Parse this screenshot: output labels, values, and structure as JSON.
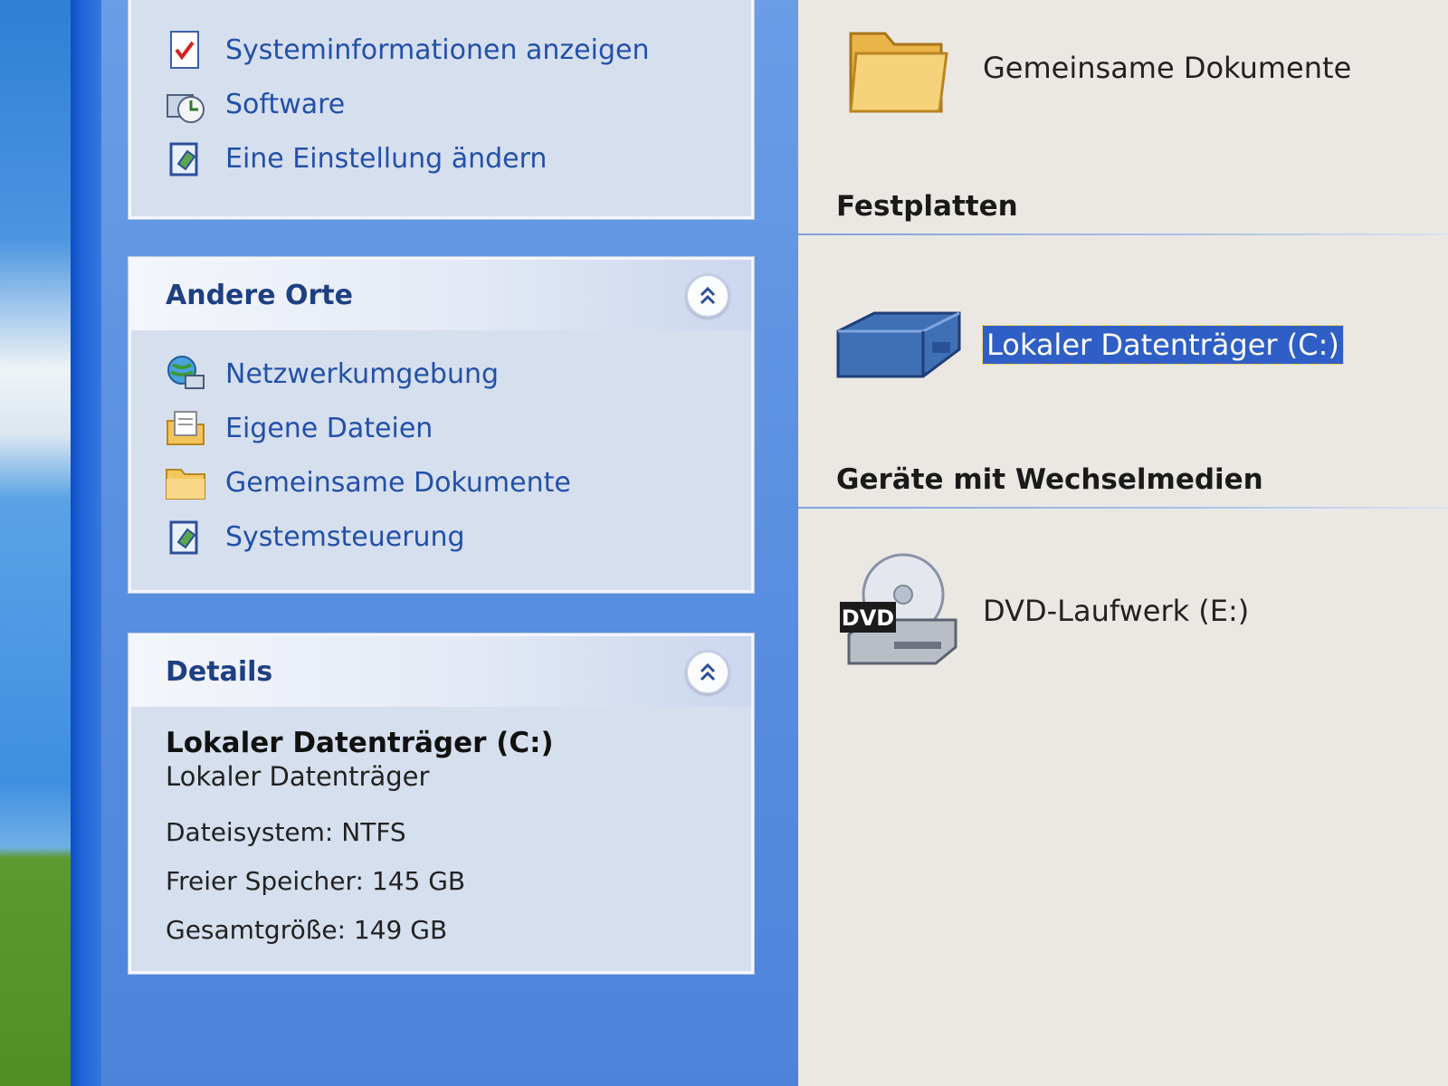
{
  "tasks_panel": {
    "items": [
      {
        "label": "Systeminformationen anzeigen",
        "icon": "system-info-icon"
      },
      {
        "label": "Software",
        "icon": "software-icon"
      },
      {
        "label": "Eine Einstellung ändern",
        "icon": "control-panel-icon"
      }
    ]
  },
  "other_places": {
    "title": "Andere Orte",
    "items": [
      {
        "label": "Netzwerkumgebung",
        "icon": "network-icon"
      },
      {
        "label": "Eigene Dateien",
        "icon": "my-documents-icon"
      },
      {
        "label": "Gemeinsame Dokumente",
        "icon": "folder-icon"
      },
      {
        "label": "Systemsteuerung",
        "icon": "control-panel-icon"
      }
    ]
  },
  "details": {
    "title": "Details",
    "name": "Lokaler Datenträger (C:)",
    "type": "Lokaler Datenträger",
    "filesystem": "Dateisystem: NTFS",
    "free": "Freier Speicher: 145 GB",
    "total": "Gesamtgröße: 149 GB"
  },
  "content": {
    "shared_docs_label": "Gemeinsame Dokumente",
    "drives_heading": "Festplatten",
    "drive_c_label": "Lokaler Datenträger (C:)",
    "removable_heading": "Geräte mit Wechselmedien",
    "dvd_label": "DVD-Laufwerk (E:)",
    "dvd_badge": "DVD"
  },
  "colors": {
    "link": "#2350a8",
    "panel_title": "#1e3f82",
    "selection": "#2f5fc6",
    "taskpane": "#5a8fe0"
  }
}
